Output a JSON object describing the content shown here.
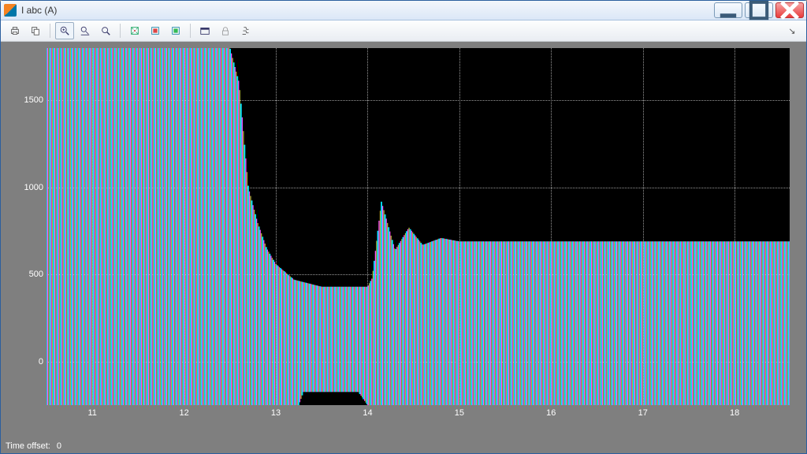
{
  "window": {
    "title": "I abc  (A)"
  },
  "toolbar": {
    "print": "print-icon",
    "copy": "copy-figure-icon",
    "zoom_in": "zoom-in-icon",
    "zoom_x": "zoom-x-icon",
    "zoom_y": "zoom-y-icon",
    "autoscale": "autoscale-icon",
    "pan": "pan-icon",
    "data_cursor": "data-cursor-icon",
    "float": "float-icon",
    "lock": "lock-icon",
    "params": "parameters-icon"
  },
  "status": {
    "label": "Time offset:",
    "value": "0"
  },
  "chart_data": {
    "type": "line",
    "title": "",
    "xlabel": "",
    "ylabel": "",
    "xlim": [
      10.5,
      18.6
    ],
    "ylim": [
      -250,
      1800
    ],
    "xticks": [
      11,
      12,
      13,
      14,
      15,
      16,
      17,
      18
    ],
    "yticks": [
      0,
      500,
      1000,
      1500
    ],
    "series_note": "Three-phase AC current (phases a,b,c) rendered as dense oscillations; values below are the upper envelope of the |I| amplitude, and a short lower-envelope dip around t=13.3–14.0.",
    "upper_envelope": {
      "x": [
        10.5,
        12.0,
        12.5,
        12.6,
        12.7,
        12.8,
        12.9,
        13.0,
        13.2,
        13.5,
        14.0,
        14.05,
        14.15,
        14.3,
        14.45,
        14.6,
        14.8,
        15.0,
        16.0,
        17.0,
        18.0,
        18.6
      ],
      "values": [
        1800,
        1800,
        1800,
        1600,
        1000,
        800,
        650,
        560,
        470,
        430,
        430,
        480,
        920,
        640,
        770,
        670,
        710,
        690,
        690,
        690,
        690,
        690
      ]
    },
    "lower_envelope_dip": {
      "x": [
        13.25,
        13.3,
        13.9,
        14.0
      ],
      "values": [
        -250,
        -175,
        -175,
        -250
      ]
    },
    "phase_colors": {
      "a": "#ffff55",
      "b": "#ff55ff",
      "c": "#00e0ff"
    }
  }
}
